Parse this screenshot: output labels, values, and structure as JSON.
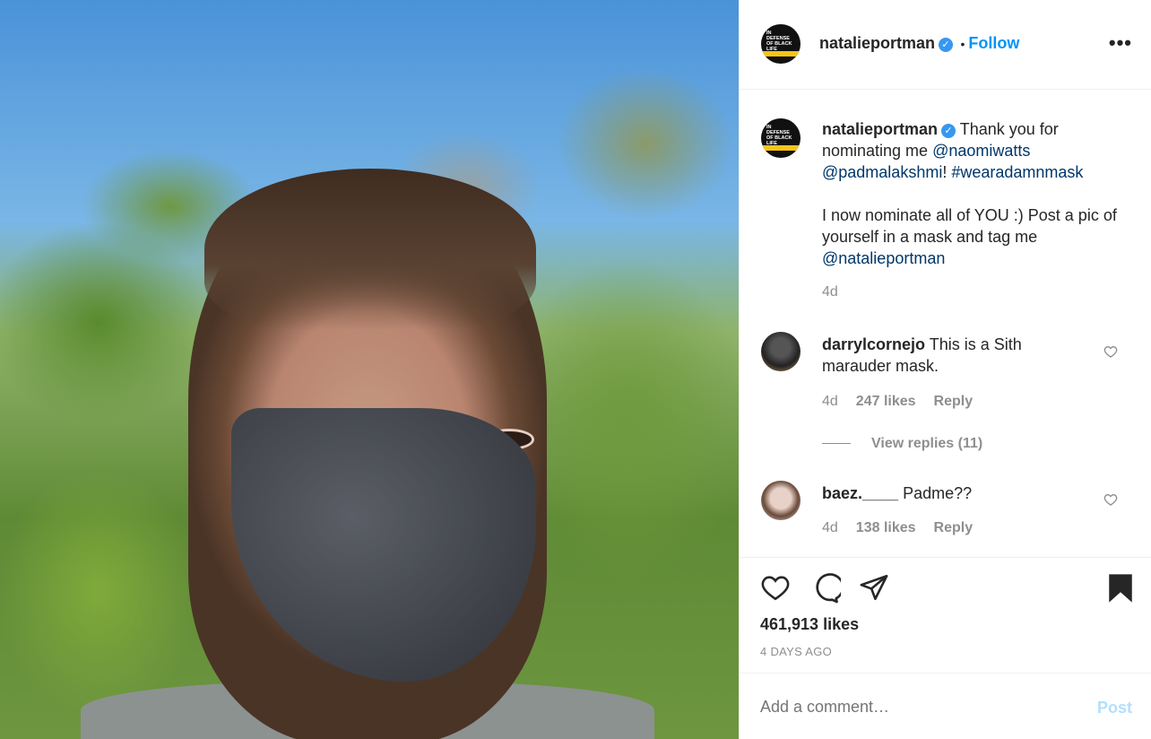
{
  "post": {
    "username": "natalieportman",
    "verified_glyph": "✓",
    "dot": "•",
    "follow_label": "Follow",
    "more_label": "•••",
    "avatar_text": "IN DEFENSE OF BLACK LIFE",
    "caption": {
      "username": "natalieportman",
      "text_1": "Thank you for nominating me ",
      "mention_1": "@naomiwatts",
      "mention_2": "@padmalakshmi",
      "text_2": "! ",
      "hashtag": "#wearadamnmask",
      "text_3": "I now nominate all of YOU :) Post a pic of yourself in a mask and tag me ",
      "mention_3": "@natalieportman",
      "age": "4d"
    },
    "comments": [
      {
        "username": "darrylcornejo",
        "text": "This is a Sith marauder mask.",
        "age": "4d",
        "likes": "247 likes",
        "reply": "Reply",
        "view_replies": "View replies (11)"
      },
      {
        "username": "baez.____",
        "text": "Padme??",
        "age": "4d",
        "likes": "138 likes",
        "reply": "Reply"
      }
    ],
    "likes_count": "461,913 likes",
    "time_ago": "4 DAYS AGO",
    "comment_placeholder": "Add a comment…",
    "post_label": "Post"
  },
  "icons": [
    "heart-icon",
    "comment-icon",
    "share-icon",
    "bookmark-icon",
    "more-icon",
    "verified-icon"
  ],
  "colors": {
    "accent": "#0095f6",
    "link": "#00376b",
    "muted": "#8e8e8e",
    "verified": "#3897f0"
  }
}
